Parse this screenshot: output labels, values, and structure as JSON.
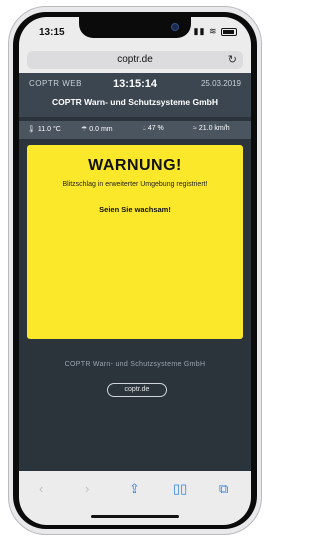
{
  "status_bar": {
    "time": "13:15",
    "signal_icon": "signal-icon",
    "wifi_icon": "wifi-icon",
    "battery_icon": "battery-icon"
  },
  "browser": {
    "url": "coptr.de"
  },
  "header": {
    "brand": "COPTR WEB",
    "clock": "13:15:14",
    "date": "25.03.2019",
    "company": "COPTR Warn- und Schutzsysteme GmbH"
  },
  "weather": {
    "temperature": "11.0 °C",
    "precipitation": "0.0 mm",
    "humidity": "47 %",
    "wind": "21.0 km/h"
  },
  "warning": {
    "title": "WARNUNG!",
    "message": "Blitzschlag in erweiterter Umgebung registriert!",
    "call_to_action": "Seien Sie wachsam!"
  },
  "footer": {
    "company": "COPTR Warn- und Schutzsysteme GmbH",
    "link": "coptr.de"
  },
  "colors": {
    "warning_background": "#fbe82b",
    "page_background": "#2b333b",
    "header_background": "#3b4650"
  }
}
